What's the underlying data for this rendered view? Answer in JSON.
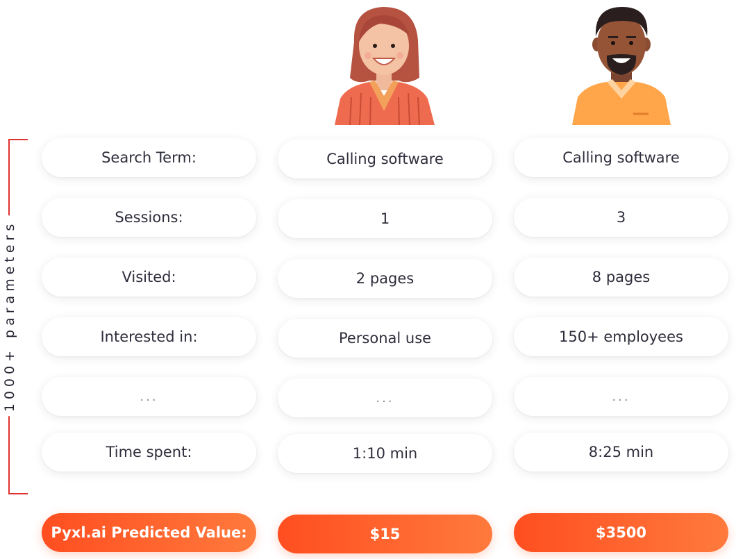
{
  "bracket_label": "1000+ parameters",
  "rows": [
    {
      "label": "Search Term:",
      "a": "Calling software",
      "b": "Calling software"
    },
    {
      "label": "Sessions:",
      "a": "1",
      "b": "3"
    },
    {
      "label": "Visited:",
      "a": "2 pages",
      "b": "8 pages"
    },
    {
      "label": "Interested in:",
      "a": "Personal use",
      "b": "150+ employees"
    },
    {
      "label": "...",
      "a": "...",
      "b": "..."
    },
    {
      "label": "Time spent:",
      "a": "1:10 min",
      "b": "8:25 min"
    }
  ],
  "prediction": {
    "label": "Pyxl.ai Predicted Value:",
    "a": "$15",
    "b": "$3500"
  },
  "colors": {
    "accent": "#ff5a2b",
    "bracket": "#e0322e",
    "woman_shirt": "#ee6b4f",
    "man_shirt": "#ffa54a"
  },
  "icons": [
    "woman-avatar-icon",
    "man-avatar-icon"
  ]
}
